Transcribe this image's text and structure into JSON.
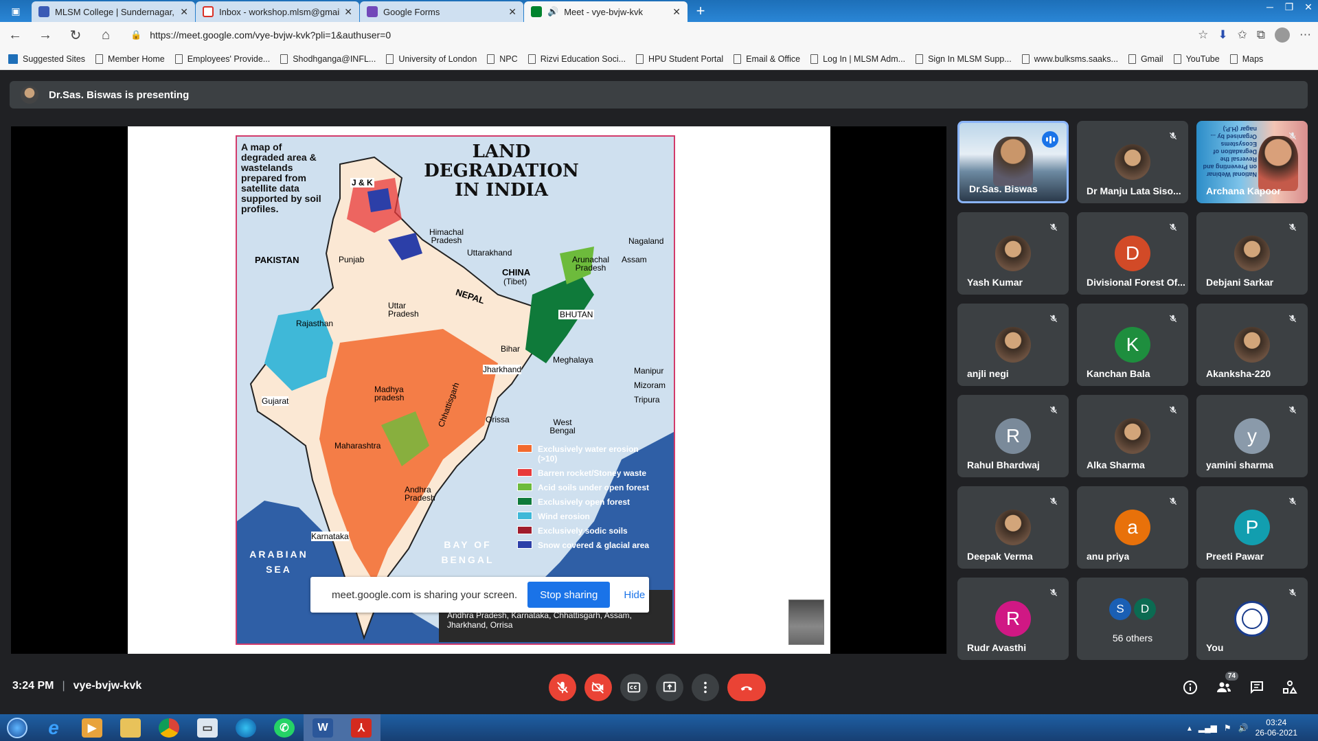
{
  "browser": {
    "tabs": [
      {
        "title": "MLSM College | Sundernagar, Mandi",
        "favicon_color": "#3b5bb5",
        "active": false
      },
      {
        "title": "Inbox - workshop.mlsm@gmail.com",
        "favicon_color": "#d93025",
        "active": false
      },
      {
        "title": "Google Forms",
        "favicon_color": "#7248b9",
        "active": false
      },
      {
        "title": "Meet - vye-bvjw-kvk",
        "favicon_color": "#00832d",
        "active": true
      }
    ],
    "url": "https://meet.google.com/vye-bvjw-kvk?pli=1&authuser=0",
    "bookmarks": [
      "Suggested Sites",
      "Member Home",
      "Employees' Provide...",
      "Shodhganga@INFL...",
      "University of London",
      "NPC",
      "Rizvi Education Soci...",
      "HPU Student Portal",
      "Email & Office",
      "Log In | MLSM Adm...",
      "Sign In MLSM Supp...",
      "www.bulksms.saaks...",
      "Gmail",
      "YouTube",
      "Maps"
    ]
  },
  "meet": {
    "presenting_text": "Dr.Sas. Biswas is presenting",
    "slide": {
      "intro_text": "A map of degraded area & wastelands prepared from satellite data supported by soil profiles.",
      "title_line1": "LAND DEGRADATION",
      "title_line2": "IN INDIA",
      "labels": {
        "jk": "J & K",
        "himachal": "Himachal Pradesh",
        "uttarakhand": "Uttarakhand",
        "pakistan": "PAKISTAN",
        "punjab": "Punjab",
        "china": "CHINA",
        "tibet": "(Tibet)",
        "nagaland": "Nagaland",
        "arunachal": "Arunachal Pradesh",
        "assam": "Assam",
        "nepal": "NEPAL",
        "uttar": "Uttar Pradesh",
        "rajasthan": "Rajasthan",
        "bhutan": "BHUTAN",
        "bihar": "Bihar",
        "meghalaya": "Meghalaya",
        "jharkhand": "Jharkhand",
        "manipur": "Manipur",
        "mizoram": "Mizoram",
        "tripura": "Tripura",
        "gujarat": "Gujarat",
        "mp": "Madhya pradesh",
        "orissa": "Orissa",
        "wbengal": "West Bengal",
        "chhattisgarh": "Chhattisgarh",
        "maharashtra": "Maharashtra",
        "andhra": "Andhra Pradesh",
        "karnataka": "Karnataka",
        "arabian": "ARABIAN SEA",
        "bay": "BAY OF BENGAL"
      },
      "legend": [
        {
          "label": "Exclusively water erosion (>10)",
          "color": "#f26a2e"
        },
        {
          "label": "Barren rocket/Stoney waste",
          "color": "#e83a3a"
        },
        {
          "label": "Acid soils under open forest",
          "color": "#6dbb3c"
        },
        {
          "label": "Exclusively open forest",
          "color": "#0f7a3a"
        },
        {
          "label": "Wind erosion",
          "color": "#3fb8d8"
        },
        {
          "label": "Exclusively sodic soils",
          "color": "#a01c2c"
        },
        {
          "label": "Snow covered & glacial area",
          "color": "#2c3fa8"
        }
      ],
      "caption_line1": "Andhra Pradesh, Karnataka, Chhattisgarh, Assam,",
      "caption_line2": "Jharkhand, Orrisa"
    },
    "share_popup": {
      "text": "meet.google.com is sharing your screen.",
      "stop_label": "Stop sharing",
      "hide_label": "Hide"
    },
    "participants": [
      {
        "name": "Dr.Sas. Biswas",
        "type": "video-speaking"
      },
      {
        "name": "Dr Manju Lata Siso...",
        "type": "photo"
      },
      {
        "name": "Archana Kapoor",
        "type": "video",
        "banner": "National Webinar on Preventing and Reversal the Degradation of Ecosystems Organised by ... nagar (H.P.)"
      },
      {
        "name": "Yash Kumar",
        "type": "photo"
      },
      {
        "name": "Divisional Forest Of...",
        "type": "letter",
        "letter": "D",
        "color": "#d24a27"
      },
      {
        "name": "Debjani Sarkar",
        "type": "photo"
      },
      {
        "name": "anjli negi",
        "type": "photo"
      },
      {
        "name": "Kanchan Bala",
        "type": "letter",
        "letter": "K",
        "color": "#1e8e3e"
      },
      {
        "name": "Akanksha-220",
        "type": "photo"
      },
      {
        "name": "Rahul Bhardwaj",
        "type": "letter",
        "letter": "R",
        "color": "#7a8a9a"
      },
      {
        "name": "Alka Sharma",
        "type": "photo"
      },
      {
        "name": "yamini sharma",
        "type": "letter",
        "letter": "y",
        "color": "#8a9aaa"
      },
      {
        "name": "Deepak Verma",
        "type": "photo"
      },
      {
        "name": "anu priya",
        "type": "letter",
        "letter": "a",
        "color": "#e8710a"
      },
      {
        "name": "Preeti Pawar",
        "type": "letter",
        "letter": "P",
        "color": "#129eaf"
      },
      {
        "name": "Rudr Avasthi",
        "type": "letter",
        "letter": "R",
        "color": "#d01884"
      },
      {
        "name": "56 others",
        "type": "others",
        "letters": [
          "S",
          "D"
        ]
      },
      {
        "name": "You",
        "type": "emblem"
      }
    ],
    "time": "3:24 PM",
    "meeting_code": "vye-bvjw-kvk",
    "people_count": "74"
  },
  "taskbar": {
    "apps": [
      "ie-icon",
      "media-player-icon",
      "file-explorer-icon",
      "chrome-icon",
      "messaging-icon",
      "edge-icon",
      "whatsapp-icon",
      "word-icon",
      "acrobat-icon"
    ],
    "clock_time": "03:24",
    "clock_date": "26-06-2021"
  }
}
